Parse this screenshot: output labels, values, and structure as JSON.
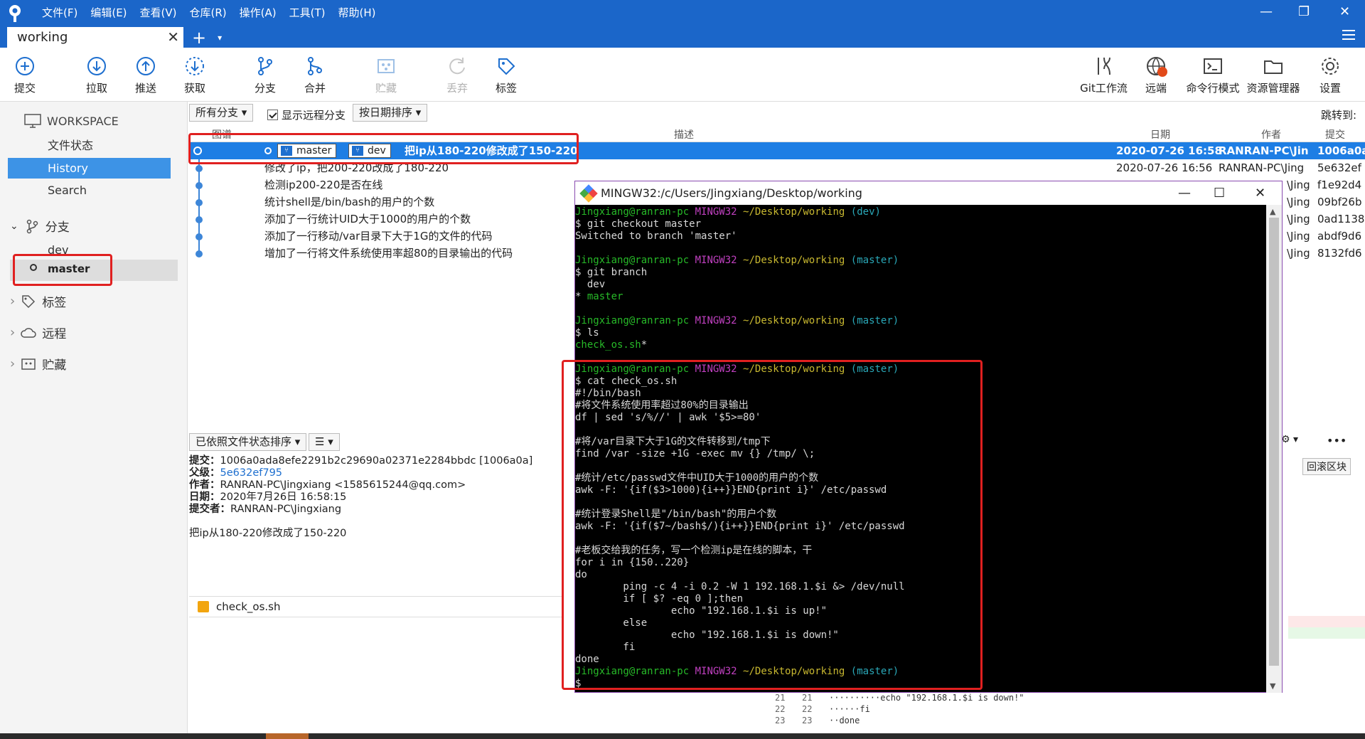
{
  "menu": [
    "文件(F)",
    "编辑(E)",
    "查看(V)",
    "仓库(R)",
    "操作(A)",
    "工具(T)",
    "帮助(H)"
  ],
  "tab": {
    "label": "working",
    "close": "✕",
    "add": "+",
    "dropdown": "▾"
  },
  "window_controls": {
    "minimize": "—",
    "restore": "❐",
    "close": "✕"
  },
  "toolbar": {
    "commit": "提交",
    "pull": "拉取",
    "push": "推送",
    "fetch": "获取",
    "branch": "分支",
    "merge": "合并",
    "stash": "贮藏",
    "discard": "丢弃",
    "tag": "标签",
    "gitflow": "Git工作流",
    "remote": "远端",
    "terminal": "命令行模式",
    "explorer": "资源管理器",
    "settings": "设置",
    "remote_badge": "!"
  },
  "sidebar": {
    "workspace": "WORKSPACE",
    "items": [
      "文件状态",
      "History",
      "Search"
    ],
    "branches_header": "分支",
    "branches": [
      "dev",
      "master"
    ],
    "tags": "标签",
    "remotes": "远程",
    "stashes": "贮藏",
    "chevron_open": "⌄",
    "chevron_closed": "›"
  },
  "filters": {
    "branches": "所有分支 ▾",
    "show_remote": "显示远程分支",
    "sort": "按日期排序 ▾",
    "jump_to": "跳转到:"
  },
  "columns": {
    "graph": "图谱",
    "description": "描述",
    "date": "日期",
    "author": "作者",
    "commit": "提交"
  },
  "commits": [
    {
      "msg": "把ip从180-220修改成了150-220",
      "date": "2020-07-26 16:58",
      "author": "RANRAN-PC\\Jin",
      "hash": "1006a0a",
      "branches": [
        "master",
        "dev"
      ]
    },
    {
      "msg": "修改了ip，把200-220改成了180-220",
      "date": "2020-07-26 16:56",
      "author": "RANRAN-PC\\Jing",
      "hash": "5e632ef"
    },
    {
      "msg": "检测ip200-220是否在线",
      "date": "",
      "author": "\\Jing",
      "hash": "f1e92d4"
    },
    {
      "msg": "统计shell是/bin/bash的用户的个数",
      "date": "",
      "author": "\\Jing",
      "hash": "09bf26b"
    },
    {
      "msg": "添加了一行统计UID大于1000的用户的个数",
      "date": "",
      "author": "\\Jing",
      "hash": "0ad1138"
    },
    {
      "msg": "添加了一行移动/var目录下大于1G的文件的代码",
      "date": "",
      "author": "\\Jing",
      "hash": "abdf9d6"
    },
    {
      "msg": "增加了一行将文件系统使用率超80的目录输出的代码",
      "date": "",
      "author": "\\Jing",
      "hash": "8132fd6"
    }
  ],
  "lower": {
    "sort": "已依照文件状态排序 ▾",
    "view": "☰ ▾",
    "commit_label": "提交：",
    "commit_value": "1006a0ada8efe2291b2c29690a02371e2284bbdc [1006a0a]",
    "parent_label": "父级：",
    "parent_value": "5e632ef795",
    "author_label": "作者：",
    "author_value": "RANRAN-PC\\Jingxiang <1585615244@qq.com>",
    "date_label": "日期：",
    "date_value": "2020年7月26日 16:58:15",
    "committer_label": "提交者：",
    "committer_value": "RANRAN-PC\\Jingxiang",
    "message": "把ip从180-220修改成了150-220",
    "file": "check_os.sh",
    "revert": "回滚区块",
    "gear": "⚙ ▾",
    "more": "•••"
  },
  "diff": [
    {
      "a": "21",
      "b": "21",
      "code": "··········echo \"192.168.1.$i is down!\""
    },
    {
      "a": "22",
      "b": "22",
      "code": "······fi"
    },
    {
      "a": "23",
      "b": "23",
      "code": "··done"
    }
  ],
  "terminal": {
    "title": "MINGW32:/c/Users/Jingxiang/Desktop/working",
    "minimize": "—",
    "maximize": "☐",
    "close": "✕",
    "prompt_user": "Jingxiang@ranran-pc",
    "prompt_env": "MINGW32",
    "prompt_path": "~/Desktop/working",
    "lines": [
      {
        "t": "prompt",
        "br": "(dev)"
      },
      {
        "t": "text",
        "s": "$ git checkout master"
      },
      {
        "t": "text",
        "s": "Switched to branch 'master'"
      },
      {
        "t": "text",
        "s": ""
      },
      {
        "t": "prompt",
        "br": "(master)"
      },
      {
        "t": "text",
        "s": "$ git branch"
      },
      {
        "t": "text",
        "s": "  dev"
      },
      {
        "t": "star",
        "s": "* ",
        "g": "master"
      },
      {
        "t": "text",
        "s": ""
      },
      {
        "t": "prompt",
        "br": "(master)"
      },
      {
        "t": "text",
        "s": "$ ls"
      },
      {
        "t": "green",
        "s": "check_os.sh",
        "w": "*"
      },
      {
        "t": "text",
        "s": ""
      },
      {
        "t": "prompt",
        "br": "(master)"
      },
      {
        "t": "text",
        "s": "$ cat check_os.sh"
      },
      {
        "t": "text",
        "s": "#!/bin/bash"
      },
      {
        "t": "text",
        "s": "#将文件系统使用率超过80%的目录输出"
      },
      {
        "t": "text",
        "s": "df | sed 's/%//' | awk '$5>=80'"
      },
      {
        "t": "text",
        "s": ""
      },
      {
        "t": "text",
        "s": "#将/var目录下大于1G的文件转移到/tmp下"
      },
      {
        "t": "text",
        "s": "find /var -size +1G -exec mv {} /tmp/ \\;"
      },
      {
        "t": "text",
        "s": ""
      },
      {
        "t": "text",
        "s": "#统计/etc/passwd文件中UID大于1000的用户的个数"
      },
      {
        "t": "text",
        "s": "awk -F: '{if($3>1000){i++}}END{print i}' /etc/passwd"
      },
      {
        "t": "text",
        "s": ""
      },
      {
        "t": "text",
        "s": "#统计登录Shell是\"/bin/bash\"的用户个数"
      },
      {
        "t": "text",
        "s": "awk -F: '{if($7~/bash$/){i++}}END{print i}' /etc/passwd"
      },
      {
        "t": "text",
        "s": ""
      },
      {
        "t": "text",
        "s": "#老板交给我的任务，写一个检测ip是在线的脚本，干"
      },
      {
        "t": "text",
        "s": "for i in {150..220}"
      },
      {
        "t": "text",
        "s": "do"
      },
      {
        "t": "text",
        "s": "        ping -c 4 -i 0.2 -W 1 192.168.1.$i &> /dev/null"
      },
      {
        "t": "text",
        "s": "        if [ $? -eq 0 ];then"
      },
      {
        "t": "text",
        "s": "                echo \"192.168.1.$i is up!\""
      },
      {
        "t": "text",
        "s": "        else"
      },
      {
        "t": "text",
        "s": "                echo \"192.168.1.$i is down!\""
      },
      {
        "t": "text",
        "s": "        fi"
      },
      {
        "t": "text",
        "s": "done"
      },
      {
        "t": "prompt",
        "br": "(master)"
      },
      {
        "t": "text",
        "s": "$"
      }
    ]
  },
  "colors": {
    "titlebar": "#1b66c9",
    "selection": "#1e7ee4",
    "annotation": "#e02020",
    "term_green": "#27b928",
    "term_magenta": "#c040c0",
    "term_yellow": "#c8b830",
    "term_cyan": "#2aa8b8"
  }
}
